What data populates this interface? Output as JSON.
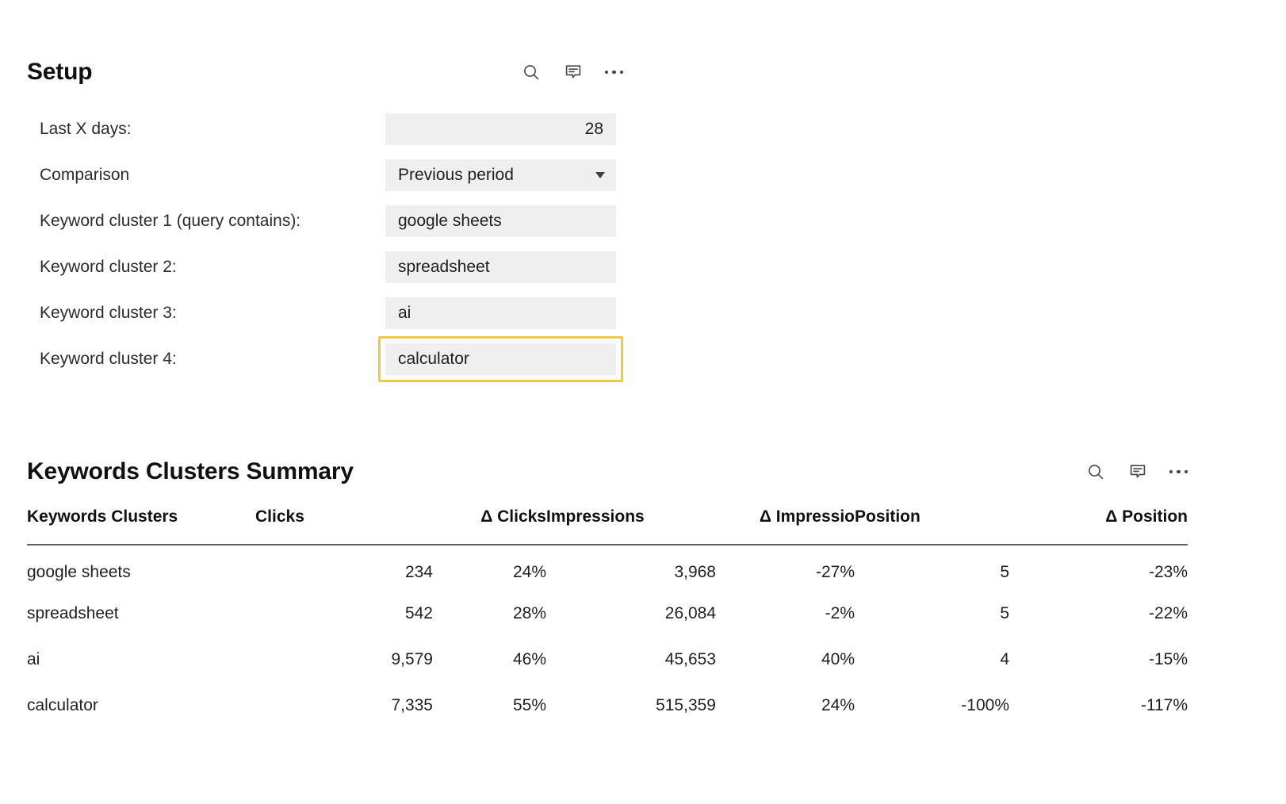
{
  "setup": {
    "title": "Setup",
    "toolbar": {
      "search_icon": "search-icon",
      "comment_icon": "comment-icon",
      "more_icon": "more-options-icon"
    },
    "rows": [
      {
        "label": "Last X days:",
        "value": "28",
        "type": "number"
      },
      {
        "label": "Comparison",
        "value": "Previous period",
        "type": "select"
      },
      {
        "label": "Keyword cluster 1 (query contains):",
        "value": "google sheets",
        "type": "text"
      },
      {
        "label": "Keyword cluster 2:",
        "value": "spreadsheet",
        "type": "text"
      },
      {
        "label": "Keyword cluster 3:",
        "value": "ai",
        "type": "text"
      },
      {
        "label": "Keyword cluster 4:",
        "value": "calculator",
        "type": "text",
        "focused": true
      }
    ]
  },
  "summary": {
    "title": "Keywords Clusters Summary",
    "toolbar": {
      "search_icon": "search-icon",
      "comment_icon": "comment-icon",
      "more_icon": "more-options-icon"
    },
    "columns": [
      "Keywords Clusters",
      "Clicks",
      "Δ Clicks",
      "Impressions",
      "Δ Impressio",
      "Position",
      "Δ Position"
    ],
    "rows": [
      {
        "cluster": "google sheets",
        "clicks": "234",
        "delta_clicks": "24%",
        "impressions": "3,968",
        "delta_impressions": "-27%",
        "position": "5",
        "delta_position": "-23%"
      },
      {
        "cluster": "spreadsheet",
        "clicks": "542",
        "delta_clicks": "28%",
        "impressions": "26,084",
        "delta_impressions": "-2%",
        "position": "5",
        "delta_position": "-22%"
      },
      {
        "cluster": "ai",
        "clicks": "9,579",
        "delta_clicks": "46%",
        "impressions": "45,653",
        "delta_impressions": "40%",
        "position": "4",
        "delta_position": "-15%"
      },
      {
        "cluster": "calculator",
        "clicks": "7,335",
        "delta_clicks": "55%",
        "impressions": "515,359",
        "delta_impressions": "24%",
        "position": "-100%",
        "delta_position": "-117%"
      }
    ]
  },
  "colors": {
    "positive": "#3d7a63",
    "negative": "#c0472e",
    "focus_ring": "#f2c744",
    "field_bg": "#efefef"
  }
}
